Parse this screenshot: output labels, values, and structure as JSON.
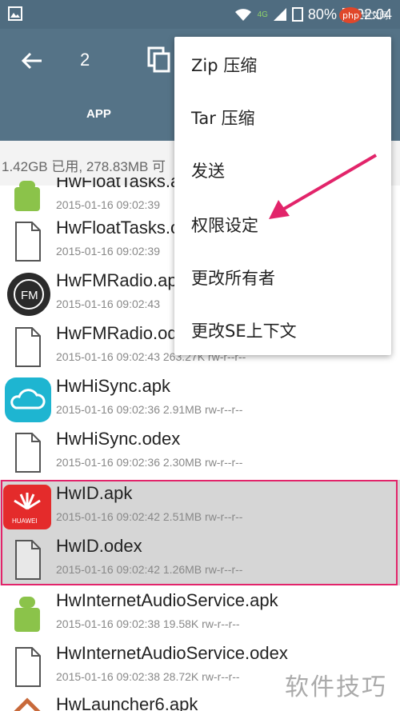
{
  "status_bar": {
    "battery": "80%",
    "time": "22:04",
    "network": "4G"
  },
  "toolbar": {
    "selected_count": "2",
    "tab_app": "APP"
  },
  "storage_info": "1.42GB 已用, 278.83MB 可",
  "menu": {
    "items": [
      "Zip 压缩",
      "Tar 压缩",
      "发送",
      "权限设定",
      "更改所有者",
      "更改SE上下文"
    ]
  },
  "files": [
    {
      "name": "HwFloatTasks.apk",
      "meta": "2015-01-16 09:02:39",
      "icon": "android-apk-icon"
    },
    {
      "name": "HwFloatTasks.odex",
      "meta": "2015-01-16 09:02:39",
      "icon": "file-icon"
    },
    {
      "name": "HwFMRadio.apk",
      "meta": "2015-01-16 09:02:43",
      "icon": "fm-radio-icon"
    },
    {
      "name": "HwFMRadio.odex",
      "meta": "2015-01-16 09:02:43  263.27K  rw-r--r--",
      "icon": "file-icon"
    },
    {
      "name": "HwHiSync.apk",
      "meta": "2015-01-16 09:02:36  2.91MB  rw-r--r--",
      "icon": "cloud-icon"
    },
    {
      "name": "HwHiSync.odex",
      "meta": "2015-01-16 09:02:36  2.30MB  rw-r--r--",
      "icon": "file-icon"
    },
    {
      "name": "HwID.apk",
      "meta": "2015-01-16 09:02:42  2.51MB  rw-r--r--",
      "icon": "huawei-icon",
      "selected": true
    },
    {
      "name": "HwID.odex",
      "meta": "2015-01-16 09:02:42  1.26MB  rw-r--r--",
      "icon": "file-icon",
      "selected": true
    },
    {
      "name": "HwInternetAudioService.apk",
      "meta": "2015-01-16 09:02:38  19.58K  rw-r--r--",
      "icon": "android-apk-icon"
    },
    {
      "name": "HwInternetAudioService.odex",
      "meta": "2015-01-16 09:02:38  28.72K  rw-r--r--",
      "icon": "file-icon"
    },
    {
      "name": "HwLauncher6.apk",
      "meta": "",
      "icon": "home-icon"
    }
  ],
  "huawei_label": "HUAWEI",
  "fm_label": "FM",
  "watermark_text": "软件技巧",
  "watermark_php": "php 中文网",
  "colors": {
    "status_bar": "#4f6c80",
    "toolbar": "#557387",
    "highlight_border": "#e2246a",
    "arrow": "#e2246a"
  }
}
